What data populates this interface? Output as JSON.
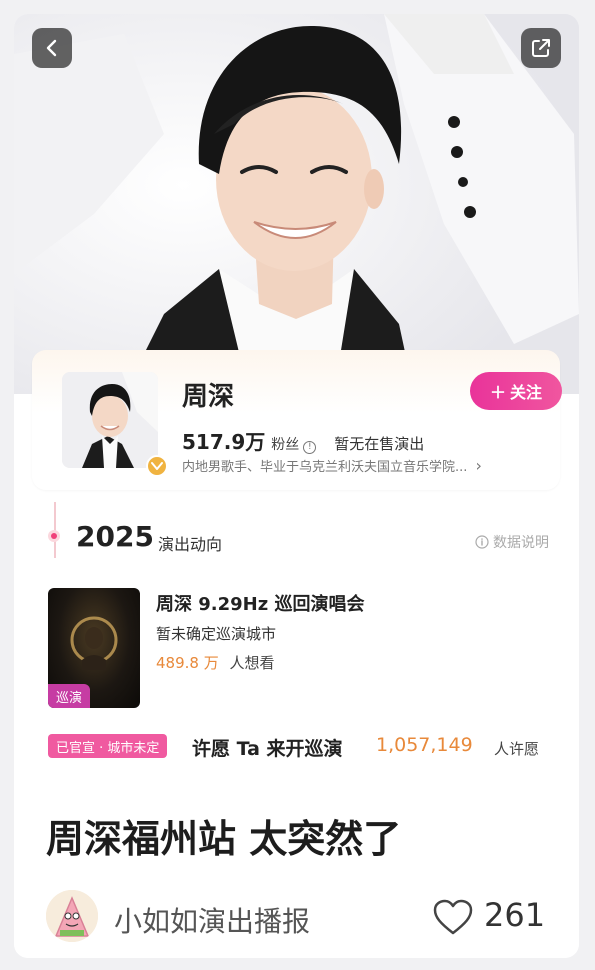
{
  "artist": {
    "name": "周深",
    "follow_label": "关注",
    "fans_count": "517.9万",
    "fans_label": "粉丝",
    "sale_status": "暂无在售演出",
    "bio": "内地男歌手、毕业于乌克兰利沃夫国立音乐学院...",
    "bio_chevron": "›"
  },
  "timeline": {
    "year": "2025",
    "subtitle": "演出动向",
    "data_note": "数据说明"
  },
  "show": {
    "tour_tag": "巡演",
    "title": "周深 9.29Hz 巡回演唱会",
    "city": "暂未确定巡演城市",
    "want_count": "489.8 万",
    "want_label": "人想看",
    "status_tag": "已官宣 · 城市未定",
    "wish_text": "许愿 Ta 来开巡演",
    "wish_count": "1,057,149",
    "wish_label": "人许愿"
  },
  "post": {
    "title": "周深福州站 太突然了",
    "author": "小如如演出播报",
    "likes": "261"
  },
  "colors": {
    "accent_pink": "#e9339a",
    "accent_orange": "#e8893a",
    "tour_tag": "#c63ca3"
  },
  "icons": {
    "back": "chevron-left-icon",
    "share": "share-icon",
    "like": "heart-outline-icon",
    "verify": "verified-badge-icon",
    "info": "info-icon"
  }
}
